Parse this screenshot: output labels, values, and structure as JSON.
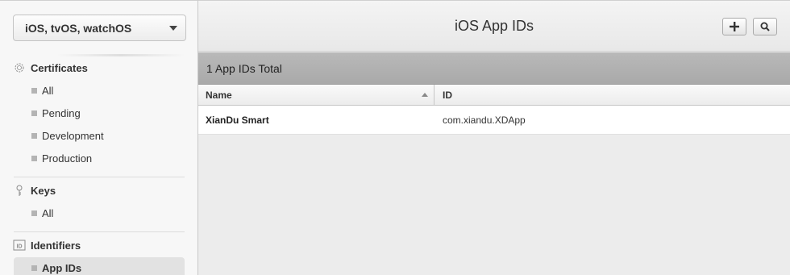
{
  "sidebar": {
    "platform_select": "iOS, tvOS, watchOS",
    "sections": [
      {
        "title": "Certificates",
        "icon": "certificate-icon",
        "items": [
          "All",
          "Pending",
          "Development",
          "Production"
        ]
      },
      {
        "title": "Keys",
        "icon": "key-icon",
        "items": [
          "All"
        ]
      },
      {
        "title": "Identifiers",
        "icon": "id-icon",
        "id_badge": "ID",
        "items": [
          "App IDs"
        ]
      }
    ],
    "active_item": "App IDs"
  },
  "header": {
    "title": "iOS App IDs",
    "add_icon": "plus-icon",
    "search_icon": "search-icon"
  },
  "list": {
    "count_text": "1 App IDs Total",
    "columns": [
      "Name",
      "ID"
    ],
    "rows": [
      {
        "name": "XianDu Smart",
        "id": "com.xiandu.XDApp"
      }
    ]
  }
}
